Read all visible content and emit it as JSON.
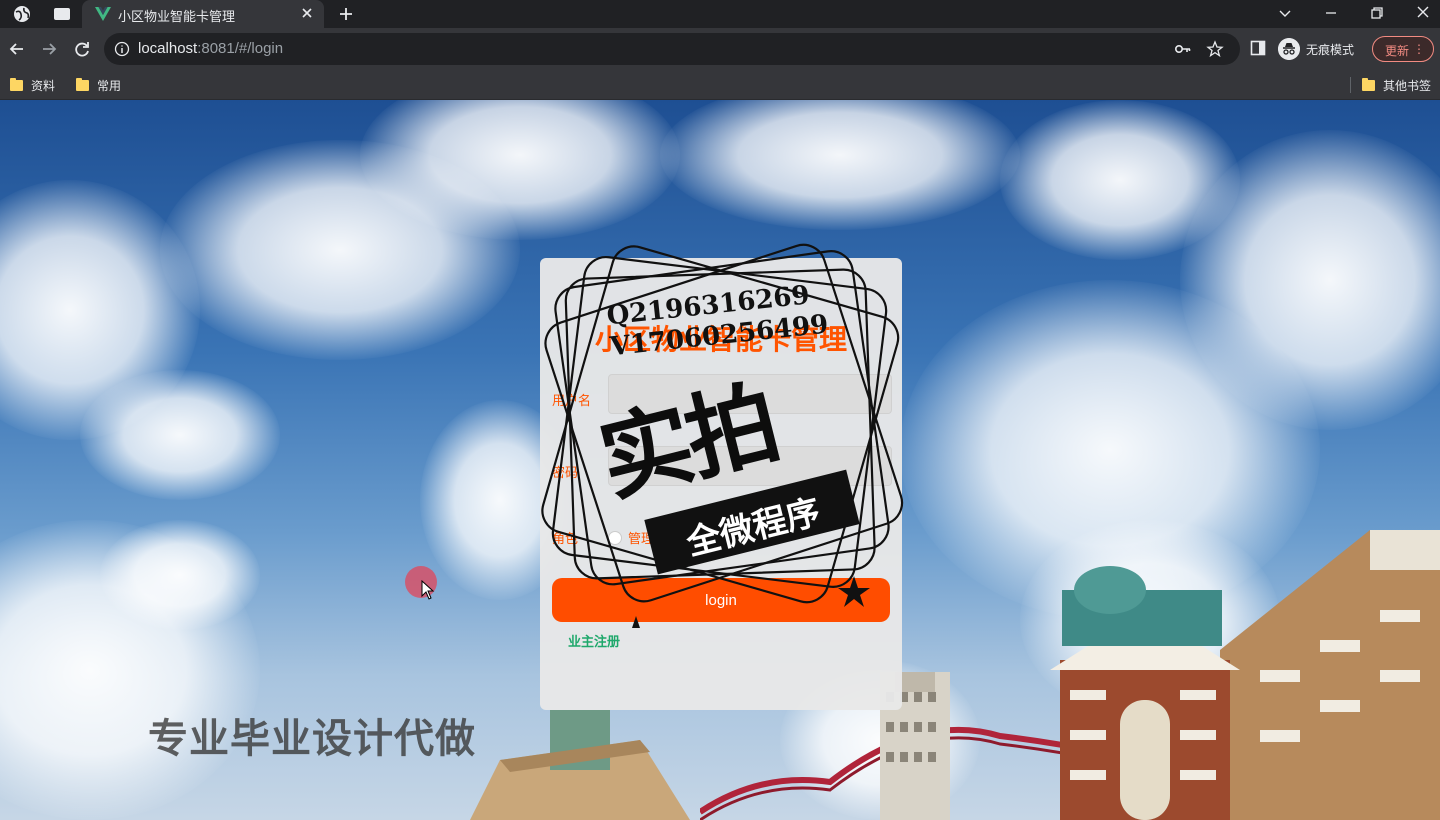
{
  "browser": {
    "tab_title": "小区物业智能卡管理",
    "url_host": "localhost",
    "url_rest": ":8081/#/login",
    "profile_label": "无痕模式",
    "update_label": "更新",
    "bookmarks": [
      "资料",
      "常用"
    ],
    "other_bookmarks": "其他书签"
  },
  "login": {
    "title": "小区物业智能卡管理",
    "username_label": "用户名",
    "password_label": "密码",
    "role_label": "角色",
    "role_option": "管理员",
    "login_button": "login",
    "register_link": "业主注册"
  },
  "overlay": {
    "watermark": "专业毕业设计代做",
    "stamp_contact": "Q2196316269\nV17060256499",
    "stamp_main": "实拍",
    "stamp_band": "全微程序"
  },
  "colors": {
    "accent": "#ff4d00",
    "title": "#ff5400",
    "register": "#1ea86b"
  }
}
